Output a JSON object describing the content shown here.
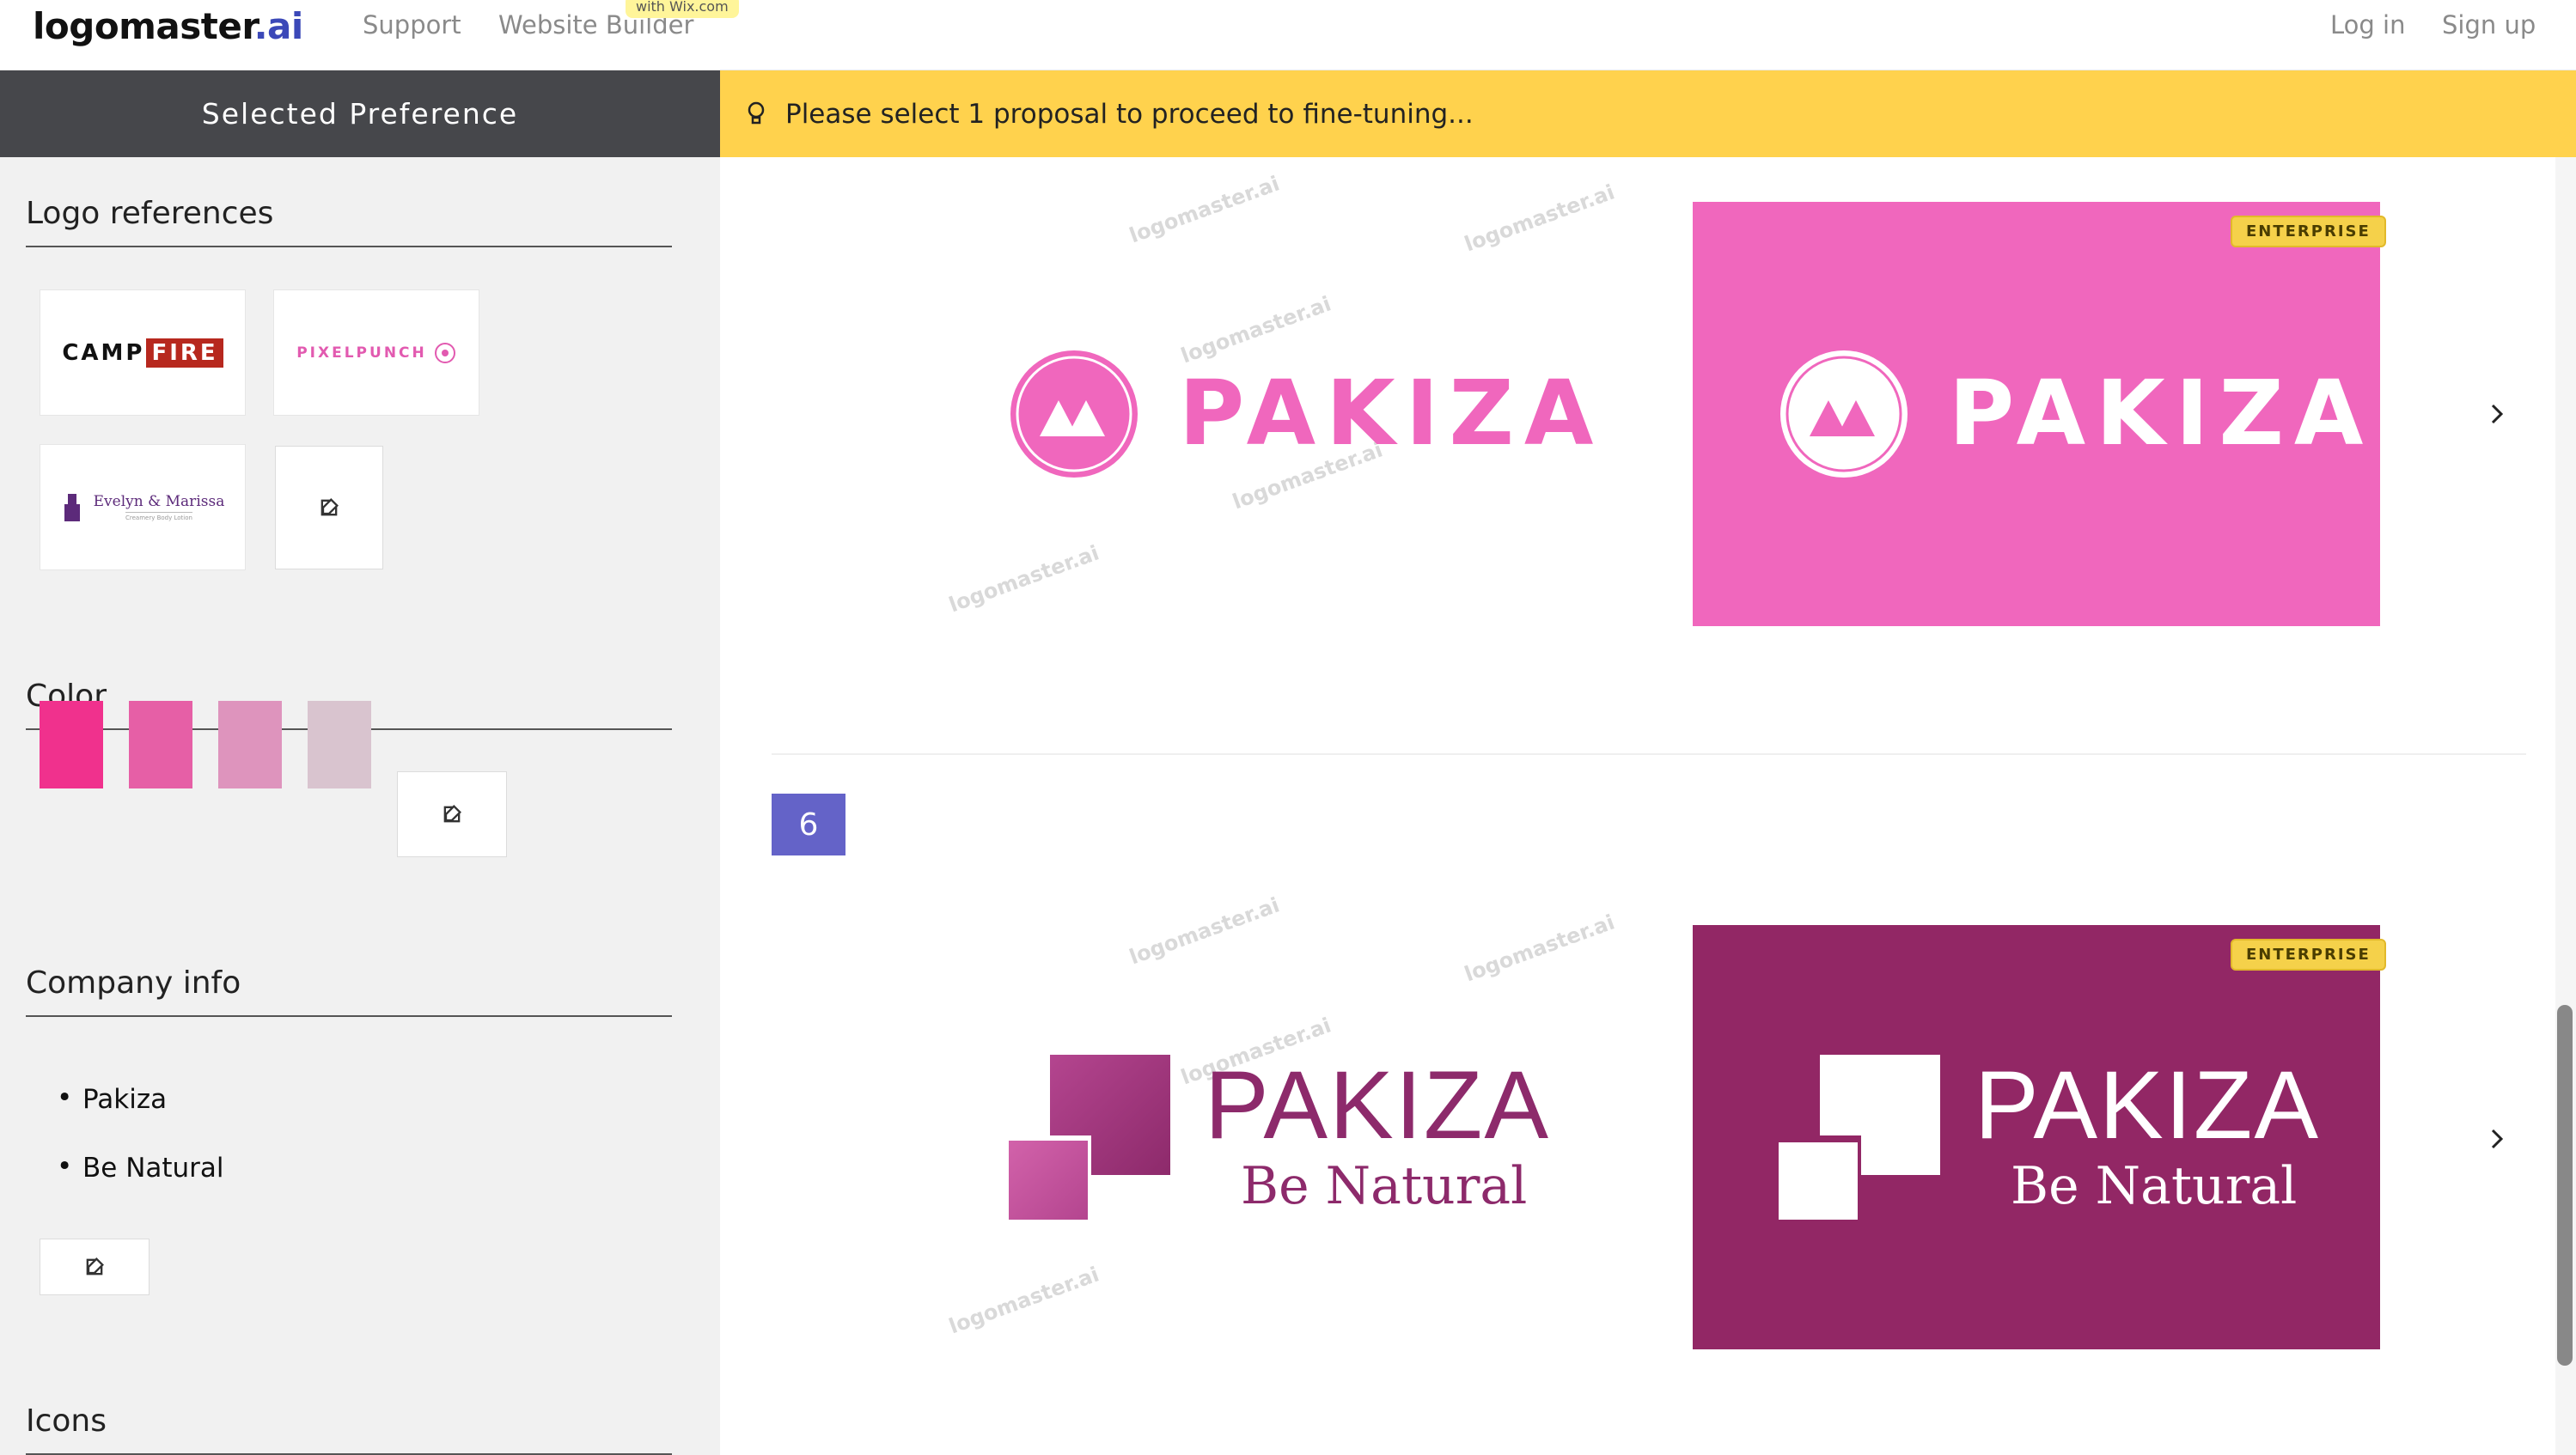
{
  "nav": {
    "logo_main": "logomaster",
    "logo_suffix": ".ai",
    "links": [
      "Support",
      "Website Builder"
    ],
    "wix_badge": "with Wix.com",
    "login": "Log in",
    "signup": "Sign up"
  },
  "sidebar": {
    "header": "Selected Preference",
    "logo_refs_title": "Logo references",
    "logo_refs": [
      {
        "name_a": "CAMP",
        "name_b": "FIRE"
      },
      {
        "name_a": "PIXELPUNCH"
      },
      {
        "name_a": "Evelyn & Marissa",
        "name_b": "Creamery Body Lotion"
      }
    ],
    "color_title": "Color",
    "colors": [
      "#f0318d",
      "#e65fa6",
      "#de94bd",
      "#d9c4cf"
    ],
    "company_title": "Company info",
    "company_items": [
      "Pakiza",
      "Be Natural"
    ],
    "icons_title": "Icons"
  },
  "banner": {
    "text": "Please select 1 proposal to proceed to fine-tuning..."
  },
  "proposals": [
    {
      "brand": "PAKIZA",
      "badge": "ENTERPRISE",
      "accent": "#f067bd",
      "card_bg": "#f067bd"
    },
    {
      "number": "6",
      "brand": "PAKIZA",
      "tagline": "Be Natural",
      "badge": "ENTERPRISE",
      "accent": "#8d2a6b",
      "card_bg": "#922765"
    }
  ],
  "watermark": "logomaster.ai"
}
